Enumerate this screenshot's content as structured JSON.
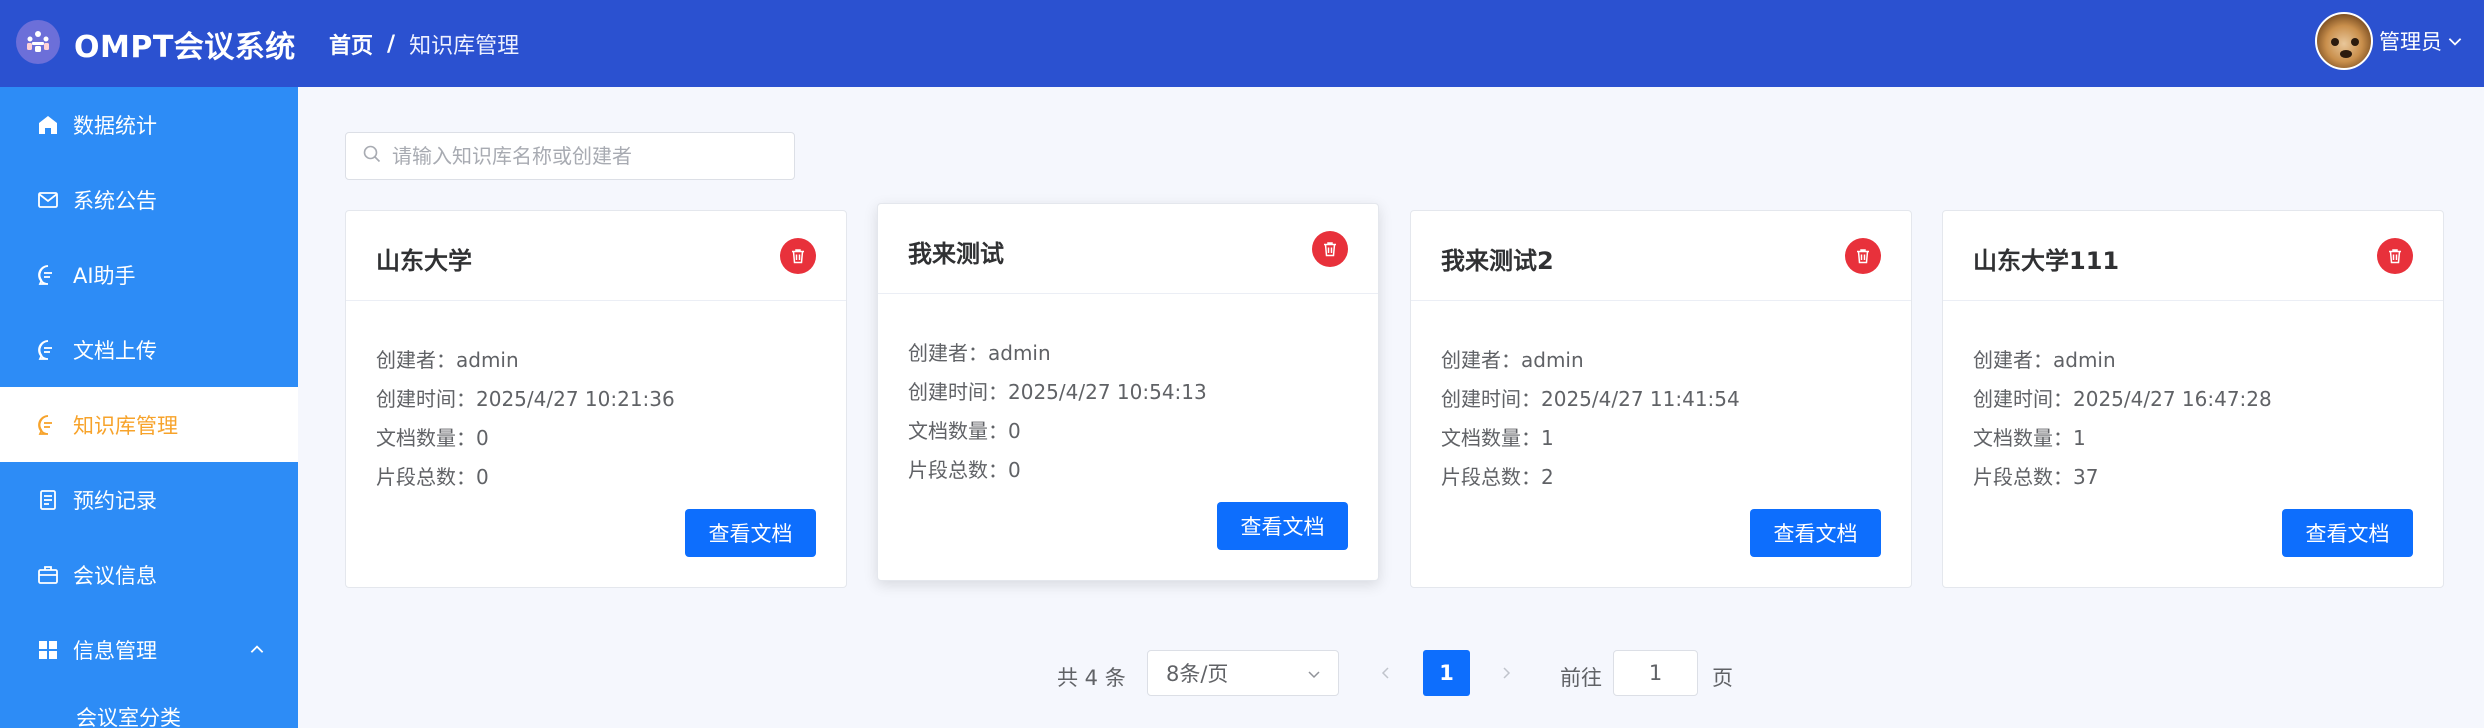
{
  "header": {
    "app_title": "OMPT会议系统",
    "breadcrumb": {
      "home": "首页",
      "separator": "/",
      "current": "知识库管理"
    },
    "user": {
      "name": "管理员"
    },
    "bg_color": "#2b51d0"
  },
  "sidebar": {
    "bg_color": "#2d8cf6",
    "active_color": "#f7a32b",
    "items": [
      {
        "label": "数据统计",
        "icon": "home-icon"
      },
      {
        "label": "系统公告",
        "icon": "mail-icon"
      },
      {
        "label": "AI助手",
        "icon": "chat-icon"
      },
      {
        "label": "文档上传",
        "icon": "chat-icon"
      },
      {
        "label": "知识库管理",
        "icon": "chat-icon",
        "active": true
      },
      {
        "label": "预约记录",
        "icon": "document-icon"
      },
      {
        "label": "会议信息",
        "icon": "briefcase-icon"
      },
      {
        "label": "信息管理",
        "icon": "grid-icon",
        "expanded": true
      }
    ],
    "sub_items": [
      {
        "label": "会议室分类"
      }
    ]
  },
  "search": {
    "placeholder": "请输入知识库名称或创建者",
    "value": ""
  },
  "card_labels": {
    "creator": "创建者：",
    "created_at": "创建时间：",
    "doc_count": "文档数量：",
    "segment_count": "片段总数：",
    "view_button": "查看文档"
  },
  "cards": [
    {
      "title": "山东大学",
      "creator": "admin",
      "created_at": "2025/4/27 10:21:36",
      "doc_count": "0",
      "segment_count": "0"
    },
    {
      "title": "我来测试",
      "creator": "admin",
      "created_at": "2025/4/27 10:54:13",
      "doc_count": "0",
      "segment_count": "0"
    },
    {
      "title": "我来测试2",
      "creator": "admin",
      "created_at": "2025/4/27 11:41:54",
      "doc_count": "1",
      "segment_count": "2"
    },
    {
      "title": "山东大学111",
      "creator": "admin",
      "created_at": "2025/4/27 16:47:28",
      "doc_count": "1",
      "segment_count": "37"
    }
  ],
  "pagination": {
    "total": "共 4 条",
    "page_size": "8条/页",
    "current_page": "1",
    "goto_label": "前往",
    "goto_value": "1",
    "goto_suffix": "页"
  }
}
